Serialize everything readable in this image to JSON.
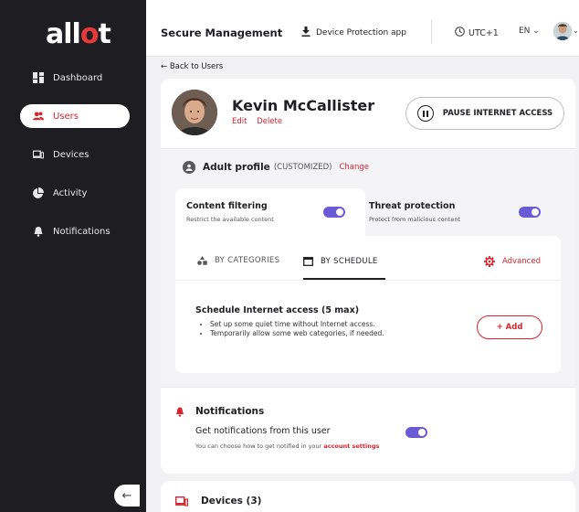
{
  "brand": {
    "logo_text_a": "all",
    "logo_text_b": "o",
    "logo_text_c": "t",
    "accent": "#d8242c",
    "toggle_color": "#6a5ad6"
  },
  "sidebar": {
    "items": [
      {
        "label": "Dashboard",
        "icon": "dashboard-icon"
      },
      {
        "label": "Users",
        "icon": "users-icon",
        "active": true
      },
      {
        "label": "Devices",
        "icon": "devices-icon"
      },
      {
        "label": "Activity",
        "icon": "activity-icon"
      },
      {
        "label": "Notifications",
        "icon": "bell-icon"
      }
    ],
    "collapse_icon": "arrow-left-icon"
  },
  "topbar": {
    "title": "Secure Management",
    "download_label": "Device Protection app",
    "timezone": "UTC+1",
    "language": "EN"
  },
  "back_link": "← Back to Users",
  "user": {
    "name": "Kevin McCallister",
    "edit_label": "Edit",
    "delete_label": "Delete",
    "pause_label": "PAUSE INTERNET ACCESS"
  },
  "profile": {
    "title": "Adult profile",
    "mode": "(CUSTOMIZED)",
    "change_label": "Change"
  },
  "tabs": {
    "content": {
      "title": "Content filtering",
      "subtitle": "Restrict the available content",
      "enabled": true
    },
    "threat": {
      "title": "Threat protection",
      "subtitle": "Protect from malicious content",
      "enabled": true
    }
  },
  "panel": {
    "by_categories": "BY CATEGORIES",
    "by_schedule": "BY SCHEDULE",
    "advanced": "Advanced",
    "schedule_title": "Schedule Internet access (5 max)",
    "bullets": [
      "Set up some quiet time without Internet access.",
      "Temporarily allow some web categories, if needed."
    ],
    "add_label": "+ Add"
  },
  "notifications": {
    "title": "Notifications",
    "label": "Get notifications from this user",
    "hint_prefix": "You can choose how to get notified in your",
    "hint_link": "account settings",
    "enabled": true
  },
  "devices": {
    "title": "Devices (3)"
  }
}
